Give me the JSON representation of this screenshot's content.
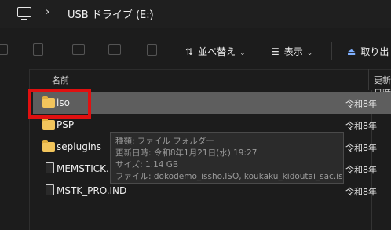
{
  "address": {
    "drive": "USB ドライブ (E:)",
    "chevron": "›"
  },
  "toolbar": {
    "sort_label": "並べ替え",
    "view_label": "表示",
    "eject_label": "取り出し",
    "dropdown": "⌄",
    "sort_icon": "⇅",
    "view_icon": "☰",
    "eject_icon": "⏏"
  },
  "columns": {
    "name": "名前",
    "date": "更新日時"
  },
  "files": [
    {
      "name": "iso",
      "type": "folder",
      "date": "令和8年",
      "selected": true
    },
    {
      "name": "PSP",
      "type": "folder",
      "date": "令和8年"
    },
    {
      "name": "seplugins",
      "type": "folder",
      "date": "令和8年"
    },
    {
      "name": "MEMSTICK.IND",
      "type": "file",
      "date": "令和8年"
    },
    {
      "name": "MSTK_PRO.IND",
      "type": "file",
      "date": "令和8年"
    }
  ],
  "tooltip": {
    "line1": "種類: ファイル フォルダー",
    "line2": "更新日時: 令和8年1月21日(水) 19:27",
    "line3": "サイズ: 1.14 GB",
    "line4": "ファイル: dokodemo_issho.ISO, koukaku_kidoutai_sac.iso"
  },
  "colors": {
    "highlight": "#e01010",
    "folder": "#f2c55c",
    "selected_row": "#5e5e5e"
  }
}
